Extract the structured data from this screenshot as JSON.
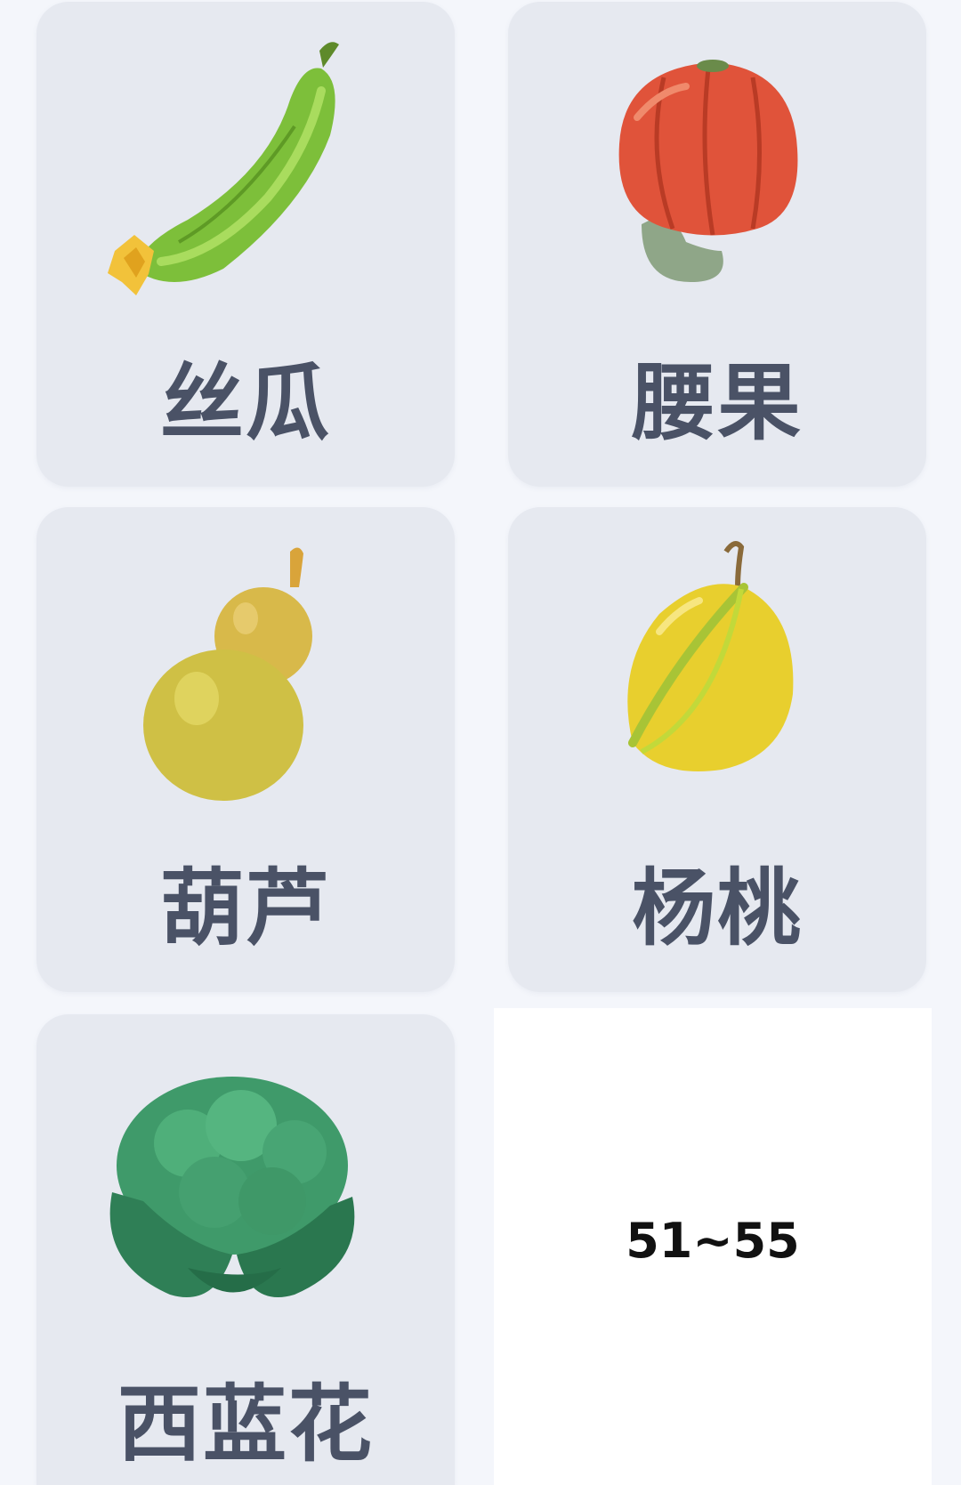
{
  "items": [
    {
      "label": "丝瓜",
      "icon": "loofah-icon"
    },
    {
      "label": "腰果",
      "icon": "cashew-icon"
    },
    {
      "label": "葫芦",
      "icon": "gourd-icon"
    },
    {
      "label": "杨桃",
      "icon": "starfruit-icon"
    },
    {
      "label": "西蓝花",
      "icon": "broccoli-icon"
    }
  ],
  "range": "51~55",
  "colors": {
    "card_bg": "#e6e9f0",
    "page_bg": "#f4f6fb",
    "label_text": "#4a5266",
    "range_text": "#111111"
  }
}
